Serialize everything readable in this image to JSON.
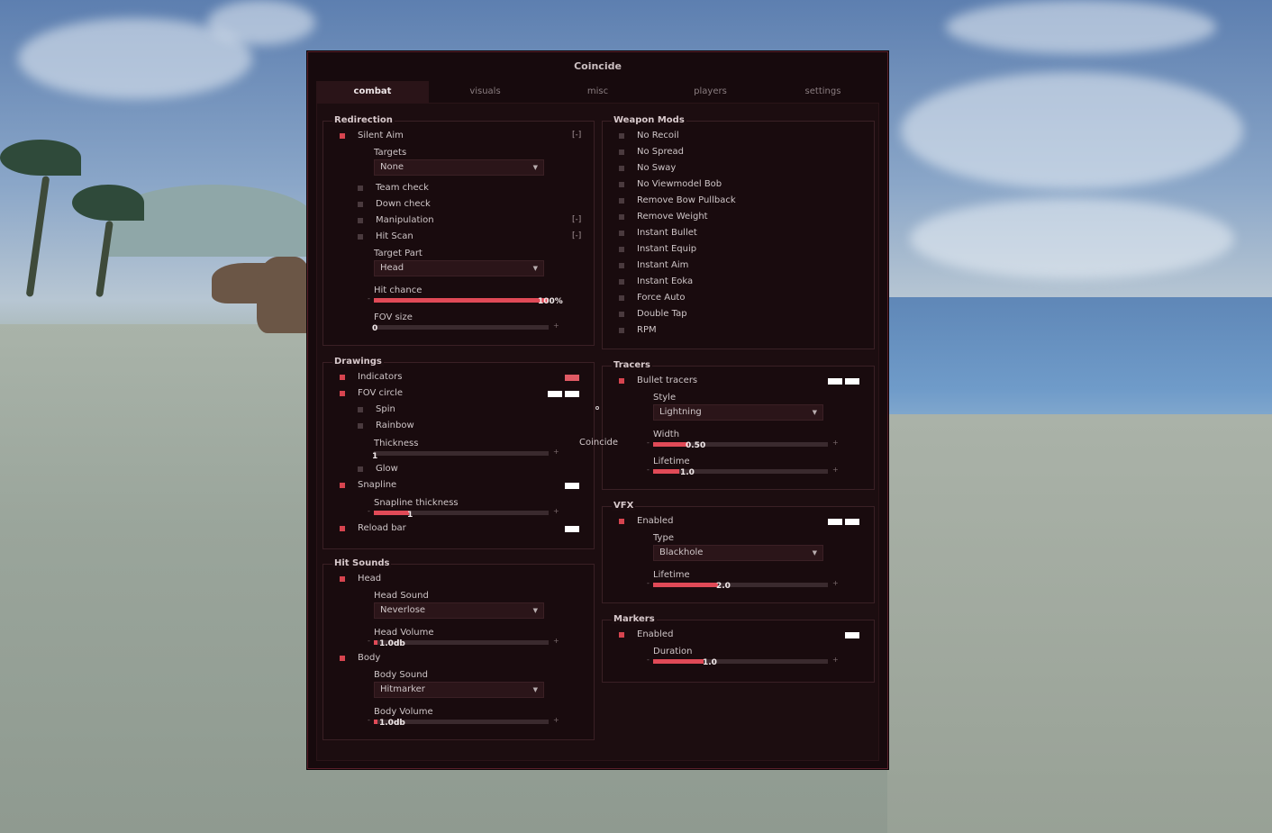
{
  "window": {
    "title": "Coincide",
    "tabs": [
      {
        "label": "combat",
        "active": true
      },
      {
        "label": "visuals",
        "active": false
      },
      {
        "label": "misc",
        "active": false
      },
      {
        "label": "players",
        "active": false
      },
      {
        "label": "settings",
        "active": false
      }
    ],
    "floating_label": "Coincide"
  },
  "colors": {
    "accent": "#e04a57",
    "background": "#170a0d"
  },
  "redirection": {
    "title": "Redirection",
    "silent_aim": {
      "label": "Silent Aim",
      "checked": true,
      "bind": "[-]"
    },
    "targets": {
      "label": "Targets",
      "value": "None"
    },
    "team_check": {
      "label": "Team check",
      "checked": false
    },
    "down_check": {
      "label": "Down check",
      "checked": false
    },
    "manipulation": {
      "label": "Manipulation",
      "checked": false,
      "bind": "[-]"
    },
    "hit_scan": {
      "label": "Hit Scan",
      "checked": false,
      "bind": "[-]"
    },
    "target_part": {
      "label": "Target Part",
      "value": "Head"
    },
    "hit_chance": {
      "label": "Hit chance",
      "value": "100%",
      "fraction": 1.0,
      "minus": "-"
    },
    "fov_size": {
      "label": "FOV size",
      "value": "0",
      "fraction": 0.0,
      "plus": "+"
    }
  },
  "drawings": {
    "title": "Drawings",
    "indicators": {
      "label": "Indicators",
      "checked": true
    },
    "fov_circle": {
      "label": "FOV circle",
      "checked": true
    },
    "spin": {
      "label": "Spin",
      "checked": false
    },
    "rainbow": {
      "label": "Rainbow",
      "checked": false
    },
    "thickness": {
      "label": "Thickness",
      "value": "1",
      "fraction": 0.0,
      "plus": "+"
    },
    "glow": {
      "label": "Glow",
      "checked": false
    },
    "snapline": {
      "label": "Snapline",
      "checked": true
    },
    "snapline_thickness": {
      "label": "Snapline thickness",
      "value": "1",
      "fraction": 0.2,
      "minus": "-",
      "plus": "+"
    },
    "reload_bar": {
      "label": "Reload bar",
      "checked": true
    }
  },
  "hit_sounds": {
    "title": "Hit Sounds",
    "head": {
      "label": "Head",
      "checked": true
    },
    "head_sound": {
      "label": "Head Sound",
      "value": "Neverlose"
    },
    "head_volume": {
      "label": "Head Volume",
      "value": "1.0db",
      "fraction": 0.02,
      "minus": "-",
      "plus": "+"
    },
    "body": {
      "label": "Body",
      "checked": true
    },
    "body_sound": {
      "label": "Body Sound",
      "value": "Hitmarker"
    },
    "body_volume": {
      "label": "Body Volume",
      "value": "1.0db",
      "fraction": 0.02,
      "minus": "-",
      "plus": "+"
    }
  },
  "weapon_mods": {
    "title": "Weapon Mods",
    "items": [
      {
        "label": "No Recoil",
        "checked": false
      },
      {
        "label": "No Spread",
        "checked": false
      },
      {
        "label": "No Sway",
        "checked": false
      },
      {
        "label": "No Viewmodel Bob",
        "checked": false
      },
      {
        "label": "Remove Bow Pullback",
        "checked": false
      },
      {
        "label": "Remove Weight",
        "checked": false
      },
      {
        "label": "Instant Bullet",
        "checked": false
      },
      {
        "label": "Instant Equip",
        "checked": false
      },
      {
        "label": "Instant Aim",
        "checked": false
      },
      {
        "label": "Instant Eoka",
        "checked": false
      },
      {
        "label": "Force Auto",
        "checked": false
      },
      {
        "label": "Double Tap",
        "checked": false
      },
      {
        "label": "RPM",
        "checked": false
      }
    ]
  },
  "tracers": {
    "title": "Tracers",
    "bullet_tracers": {
      "label": "Bullet tracers",
      "checked": true
    },
    "style": {
      "label": "Style",
      "value": "Lightning"
    },
    "width": {
      "label": "Width",
      "value": "0.50",
      "fraction": 0.2,
      "minus": "-",
      "plus": "+"
    },
    "lifetime": {
      "label": "Lifetime",
      "value": "1.0",
      "fraction": 0.15,
      "minus": "-",
      "plus": "+"
    }
  },
  "vfx": {
    "title": "VFX",
    "enabled": {
      "label": "Enabled",
      "checked": true
    },
    "type": {
      "label": "Type",
      "value": "Blackhole"
    },
    "lifetime": {
      "label": "Lifetime",
      "value": "2.0",
      "fraction": 0.37,
      "minus": "-",
      "plus": "+"
    }
  },
  "markers": {
    "title": "Markers",
    "enabled": {
      "label": "Enabled",
      "checked": true
    },
    "duration": {
      "label": "Duration",
      "value": "1.0",
      "fraction": 0.29,
      "minus": "-",
      "plus": "+"
    }
  }
}
